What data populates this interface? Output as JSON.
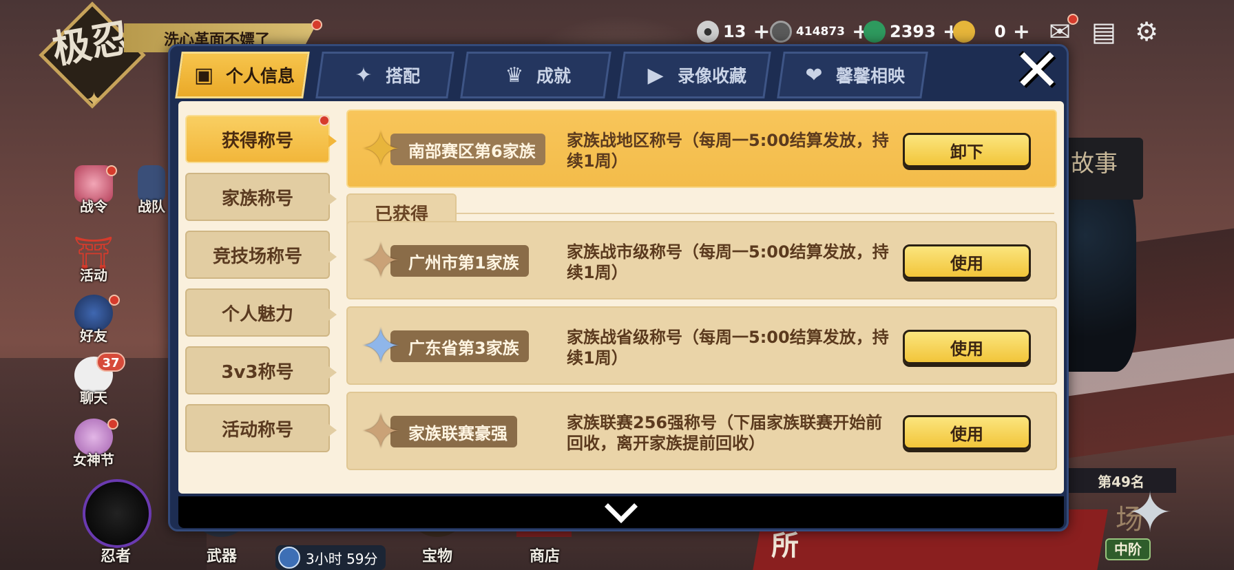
{
  "header": {
    "logo_text": "极忍",
    "player_title": "洗心革面不嫖了",
    "resources": [
      {
        "icon": "rice-ball-icon",
        "value": "13",
        "color": "#cfcfcf"
      },
      {
        "icon": "coin-icon",
        "value": "414873",
        "color": "#9e9e9e"
      },
      {
        "icon": "jade-icon",
        "value": "2393",
        "color": "#2e9a5e"
      },
      {
        "icon": "gourd-icon",
        "value": "0",
        "color": "#e6b53a"
      }
    ]
  },
  "sidebar": {
    "items": [
      {
        "label": "战令",
        "icon": "rose-icon"
      },
      {
        "label": "战队",
        "icon": "swords-icon"
      },
      {
        "label": "活动",
        "icon": "torii-icon"
      },
      {
        "label": "好友",
        "icon": "ninja-head-icon"
      },
      {
        "label": "聊天",
        "icon": "chat-bubble-icon",
        "badge": "37"
      },
      {
        "label": "女神节",
        "icon": "flower-icon"
      }
    ]
  },
  "bottom": {
    "items": [
      "忍者",
      "武器",
      "宝物",
      "商店"
    ],
    "timer": "3小时 59分",
    "rank": "第49名",
    "rank_level": "中阶"
  },
  "background": {
    "scroll_text": "故事",
    "banner_text": "所",
    "banner_text2": "场"
  },
  "modal": {
    "tabs": [
      {
        "label": "个人信息",
        "icon": "profile-card-icon",
        "active": true
      },
      {
        "label": "搭配",
        "icon": "shuriken-icon"
      },
      {
        "label": "成就",
        "icon": "trophy-icon"
      },
      {
        "label": "录像收藏",
        "icon": "play-icon"
      },
      {
        "label": "馨馨相映",
        "icon": "hearts-icon"
      }
    ],
    "categories": [
      {
        "label": "获得称号",
        "active": true,
        "dot": true
      },
      {
        "label": "家族称号"
      },
      {
        "label": "竞技场称号"
      },
      {
        "label": "个人魅力"
      },
      {
        "label": "3v3称号"
      },
      {
        "label": "活动称号"
      }
    ],
    "equipped": {
      "name": "南部赛区第6家族",
      "desc": "家族战地区称号（每周一5:00结算发放，持续1周）",
      "button": "卸下",
      "emblem": "gold"
    },
    "section_label": "已获得",
    "titles": [
      {
        "name": "广州市第1家族",
        "desc": "家族战市级称号（每周一5:00结算发放，持续1周）",
        "button": "使用",
        "emblem": "bronze"
      },
      {
        "name": "广东省第3家族",
        "desc": "家族战省级称号（每周一5:00结算发放，持续1周）",
        "button": "使用",
        "emblem": "blue"
      },
      {
        "name": "家族联赛豪强",
        "desc": "家族联赛256强称号（下届家族联赛开始前回收，离开家族提前回收）",
        "button": "使用",
        "emblem": "bronze"
      }
    ]
  },
  "colors": {
    "accent_gold": "#f2b63a",
    "modal_navy": "#1d2d52",
    "panel_cream": "#faf0dd"
  }
}
